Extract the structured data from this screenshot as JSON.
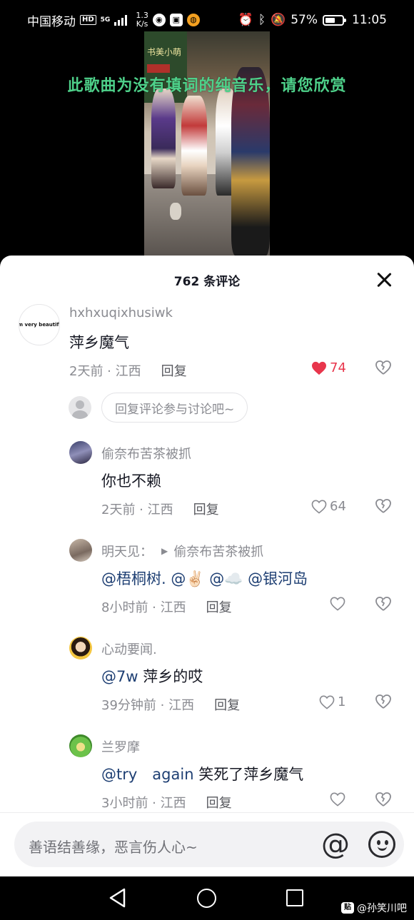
{
  "status_bar": {
    "carrier": "中国移动",
    "hd": "HD",
    "network_5g": "5G",
    "network_sub": "4G",
    "speed_value": "1.3",
    "speed_unit": "K/s",
    "battery": "57%",
    "time": "11:05"
  },
  "video": {
    "caption": "此歌曲为没有填词的纯音乐，请您欣赏",
    "shop_sign": "书美小萌"
  },
  "comments_panel": {
    "title": "762 条评论",
    "comments": [
      {
        "username": "hxhxuqixhusiwk",
        "avatar_text": "I'm very beautiful",
        "text": "萍乡魔气",
        "time_loc": "2天前 · 江西",
        "reply": "回复",
        "likes": "74",
        "liked": true
      },
      {
        "username": "偷奈布苦茶被抓",
        "text": "你也不赖",
        "time_loc": "2天前 · 江西",
        "reply": "回复",
        "likes": "64"
      },
      {
        "username": "明天见：",
        "reply_to": "偷奈布苦茶被抓",
        "mentions": [
          "@梧桐树.",
          "@✌🏻",
          "@☁️",
          "@银河岛"
        ],
        "time_loc": "8小时前 · 江西",
        "reply": "回复",
        "likes": ""
      },
      {
        "username": "心动要闻.",
        "mention": "@7w",
        "text": " 萍乡的哎",
        "time_loc": "39分钟前 · 江西",
        "reply": "回复",
        "likes": "1"
      },
      {
        "username": "兰罗摩",
        "mention": "@try　again",
        "text": " 笑死了萍乡魔气",
        "time_loc": "3小时前 · 江西",
        "reply": "回复",
        "likes": ""
      }
    ],
    "reply_prompt": "回复评论参与讨论吧~"
  },
  "input_bar": {
    "placeholder": "善语结善缘，恶言伤人心~",
    "at_symbol": "@"
  },
  "watermark": {
    "text": "@孙笑川吧",
    "icon_text": "贴"
  },
  "colors": {
    "liked_heart": "#e8364c",
    "mention": "#1e3f73",
    "caption": "#4ed18a"
  }
}
